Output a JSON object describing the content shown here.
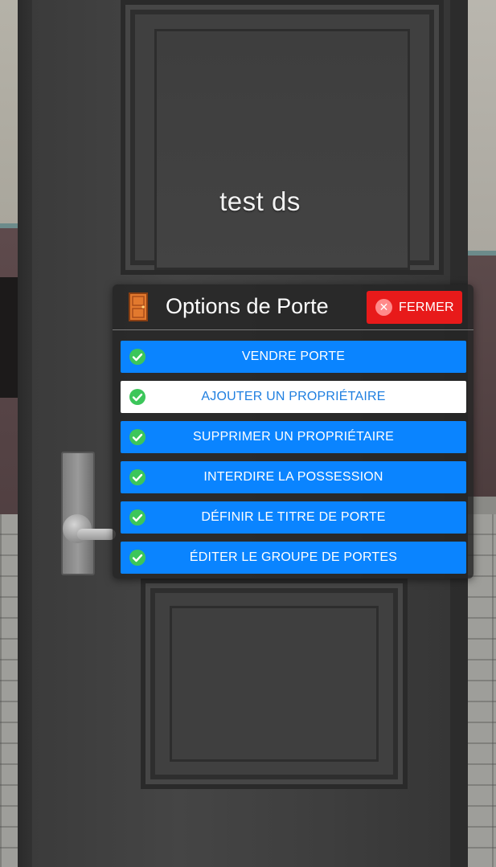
{
  "scene": {
    "door_label": "test ds"
  },
  "menu": {
    "title": "Options de Porte",
    "close_label": "FERMER",
    "options": [
      {
        "label": "VENDRE PORTE",
        "selected": false
      },
      {
        "label": "AJOUTER UN PROPRIÉTAIRE",
        "selected": true
      },
      {
        "label": "SUPPRIMER UN PROPRIÉTAIRE",
        "selected": false
      },
      {
        "label": "INTERDIRE LA POSSESSION",
        "selected": false
      },
      {
        "label": "DÉFINIR LE TITRE DE PORTE",
        "selected": false
      },
      {
        "label": "ÉDITER LE GROUPE DE PORTES",
        "selected": false
      }
    ]
  },
  "icons": {
    "header": "door-icon",
    "close": "close-icon",
    "option": "check-circle-icon"
  },
  "colors": {
    "option_background": "#0a84ff",
    "option_selected_background": "#ffffff",
    "option_selected_text": "#1f7fe0",
    "close_button": "#e81a1a",
    "check_green": "#3cc65a",
    "door_icon": "#e2792e"
  }
}
